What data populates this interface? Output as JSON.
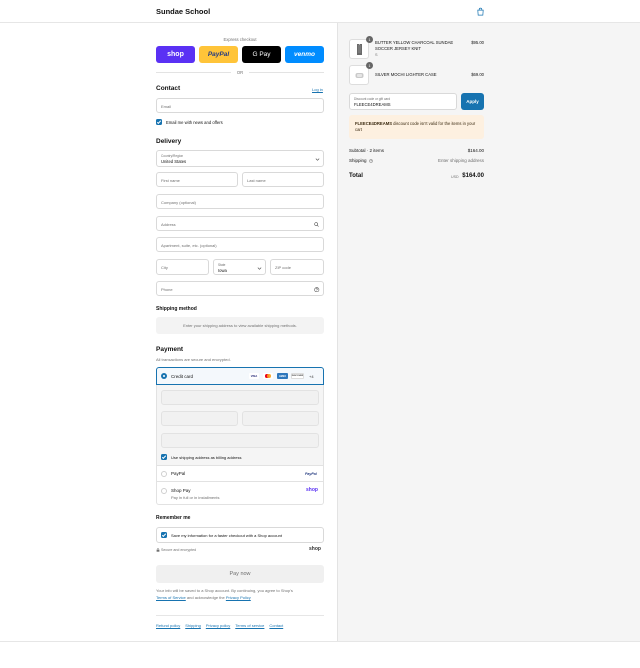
{
  "header": {
    "brand": "Sundae School"
  },
  "express": {
    "title": "Express checkout",
    "buttons": [
      "shop",
      "PayPal",
      "G Pay",
      "venmo"
    ],
    "or": "OR"
  },
  "contact": {
    "title": "Contact",
    "login": "Log in",
    "email_placeholder": "Email",
    "news_label": "Email me with news and offers"
  },
  "delivery": {
    "title": "Delivery",
    "country_label": "Country/Region",
    "country_value": "United States",
    "first_name": "First name",
    "last_name": "Last name",
    "company": "Company (optional)",
    "address": "Address",
    "apartment": "Apartment, suite, etc. (optional)",
    "city": "City",
    "state_label": "State",
    "state_value": "Iowa",
    "zip": "ZIP code",
    "phone": "Phone"
  },
  "shipping_method": {
    "title": "Shipping method",
    "note": "Enter your shipping address to view available shipping methods."
  },
  "payment": {
    "title": "Payment",
    "subtitle": "All transactions are secure and encrypted.",
    "credit_card": "Credit card",
    "card_brands": [
      "VISA",
      "",
      "AMEX",
      "DISCOVER",
      "+4"
    ],
    "billing_label": "Use shipping address as billing address",
    "paypal": "PayPal",
    "paypal_logo": "PayPal",
    "shoppay": "Shop Pay",
    "shoppay_sub": "Pay in full or in installments",
    "shop_logo": "shop"
  },
  "remember": {
    "title": "Remember me",
    "save_label": "Save my information for a faster checkout with a Shop account",
    "secure": "Secure and encrypted",
    "shop_logo": "shop"
  },
  "pay_button": "Pay now",
  "legal": {
    "line1": "Your info will be saved to a Shop account. By continuing, you agree to Shop's",
    "tos": "Terms of Service",
    "and": "and acknowledge the",
    "privacy": "Privacy Policy"
  },
  "footer_links": [
    "Refund policy",
    "Shipping",
    "Privacy policy",
    "Terms of service",
    "Contact"
  ],
  "cart": {
    "items": [
      {
        "qty": "1",
        "name": "BUTTER YELLOW CHARCOAL SUNDAE SOCCER JERSEY KNIT",
        "variant": "S",
        "price": "$95.00"
      },
      {
        "qty": "1",
        "name": "SILVER MOCHI LIGHTER CASE",
        "variant": "",
        "price": "$69.00"
      }
    ],
    "discount_label": "Discount code or gift card",
    "discount_value": "FLEECE4DREAMS",
    "apply": "Apply",
    "warning_code": "FLEECE4DREAMS",
    "warning_text": "discount code isn't valid for the items in your cart",
    "subtotal_label": "Subtotal · 2 items",
    "subtotal_value": "$164.00",
    "shipping_label": "Shipping",
    "shipping_value": "Enter shipping address",
    "total_label": "Total",
    "currency": "USD",
    "total_value": "$164.00"
  },
  "colors": {
    "accent": "#1773b0",
    "shop_purple": "#5a31f4",
    "paypal_yellow": "#ffc439",
    "venmo_blue": "#008cff",
    "warning_bg": "#fdf0e0"
  }
}
